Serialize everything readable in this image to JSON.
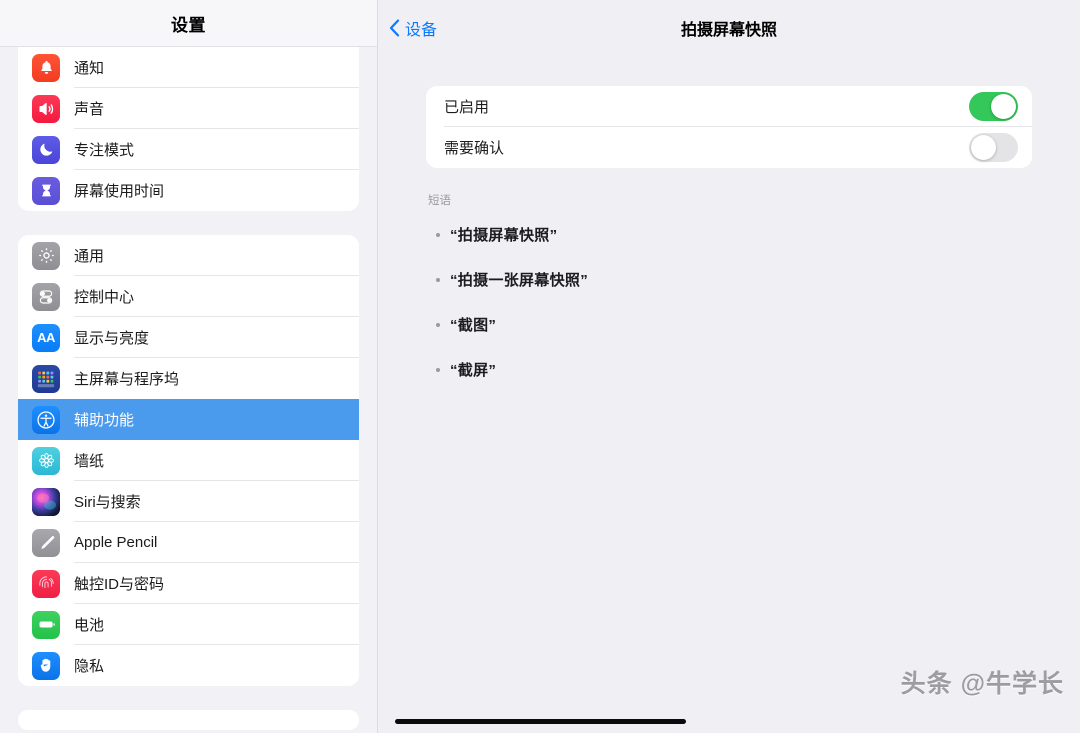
{
  "sidebar": {
    "title": "设置",
    "groups": [
      {
        "items": [
          {
            "label": "通知",
            "icon": "bell-icon",
            "selected": false
          },
          {
            "label": "声音",
            "icon": "speaker-icon",
            "selected": false
          },
          {
            "label": "专注模式",
            "icon": "moon-icon",
            "selected": false
          },
          {
            "label": "屏幕使用时间",
            "icon": "hourglass-icon",
            "selected": false
          }
        ]
      },
      {
        "items": [
          {
            "label": "通用",
            "icon": "gear-icon",
            "selected": false
          },
          {
            "label": "控制中心",
            "icon": "sliders-icon",
            "selected": false
          },
          {
            "label": "显示与亮度",
            "icon": "text-size-icon",
            "selected": false
          },
          {
            "label": "主屏幕与程序坞",
            "icon": "home-screen-icon",
            "selected": false
          },
          {
            "label": "辅助功能",
            "icon": "accessibility-icon",
            "selected": true
          },
          {
            "label": "墙纸",
            "icon": "wallpaper-icon",
            "selected": false
          },
          {
            "label": "Siri与搜索",
            "icon": "siri-icon",
            "selected": false
          },
          {
            "label": "Apple Pencil",
            "icon": "pencil-icon",
            "selected": false
          },
          {
            "label": "触控ID与密码",
            "icon": "fingerprint-icon",
            "selected": false
          },
          {
            "label": "电池",
            "icon": "battery-icon",
            "selected": false
          },
          {
            "label": "隐私",
            "icon": "hand-icon",
            "selected": false
          }
        ]
      }
    ]
  },
  "detail": {
    "back_label": "设备",
    "back_icon": "chevron-left-icon",
    "title": "拍摄屏幕快照",
    "settings": [
      {
        "label": "已启用",
        "toggle": "on"
      },
      {
        "label": "需要确认",
        "toggle": "off"
      }
    ],
    "phrases_section_label": "短语",
    "phrases": [
      "“拍摄屏幕快照”",
      "“拍摄一张屏幕快照”",
      "“截图”",
      "“截屏”"
    ]
  },
  "watermark": "头条 @牛学长",
  "colors": {
    "accent_blue": "#0a7aff",
    "selected_row": "#4a9aee",
    "toggle_on": "#34c759",
    "toggle_off": "#e4e4e6",
    "page_background": "#f0f0f4",
    "card_background": "#ffffff"
  }
}
